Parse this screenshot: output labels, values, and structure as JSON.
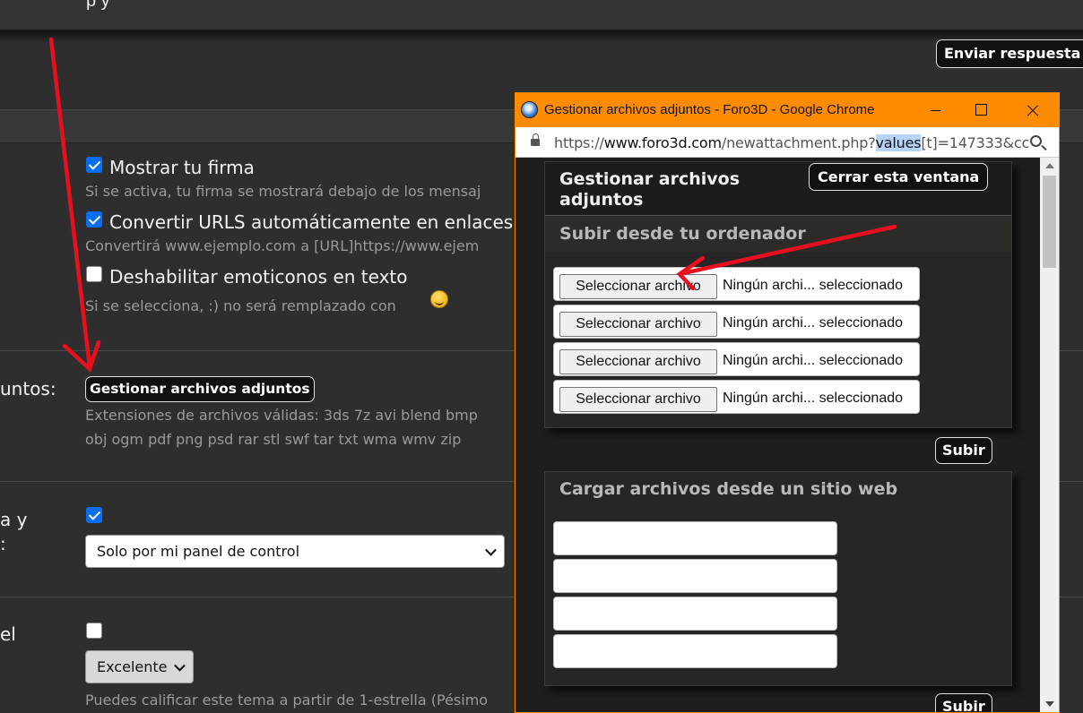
{
  "page": {
    "top_text": "p         y",
    "send_reply_label": "Enviar respuesta",
    "options": [
      {
        "label": "Mostrar tu firma",
        "description": "Si se activa, tu firma se mostrará debajo de los mensaj",
        "checked": true
      },
      {
        "label": "Convertir URLS automáticamente en enlaces",
        "description": "Convertirá www.ejemplo.com a [URL]https://www.ejem",
        "checked": true
      },
      {
        "label": "Deshabilitar emoticonos en texto",
        "description": "Si se selecciona, :) no será remplazado con",
        "checked": false
      }
    ],
    "attachments": {
      "left_label": "untos:",
      "button_label": "Gestionar archivos adjuntos",
      "extensions_line1": "Extensiones de archivos válidas: 3ds 7z avi blend bmp",
      "extensions_line2": "obj ogm pdf png psd rar stl swf tar txt wma wmv zip"
    },
    "subscription": {
      "left_label_1": "a y",
      "left_label_2": ":",
      "checked": true,
      "select_value": "Solo por mi panel de control"
    },
    "rating": {
      "left_label": "el",
      "checked": false,
      "select_value": "Excelente",
      "description": "Puedes calificar este tema a partir de 1-estrella (Pésimo"
    }
  },
  "popup": {
    "window_title": "Gestionar archivos adjuntos - Foro3D - Google Chrome",
    "url_prefix": "https://",
    "url_domain": "www.foro3d.com",
    "url_path": "/newattachment.php?",
    "url_highlight": "values",
    "url_rest": "[t]=147333&cc",
    "panel_title_line1": "Gestionar archivos",
    "panel_title_line2": "adjuntos",
    "close_window_label": "Cerrar esta ventana",
    "upload_section_title": "Subir desde tu ordenador",
    "file_inputs": [
      {
        "button": "Seleccionar archivo",
        "status": "Ningún archi... seleccionado"
      },
      {
        "button": "Seleccionar archivo",
        "status": "Ningún archi... seleccionado"
      },
      {
        "button": "Seleccionar archivo",
        "status": "Ningún archi... seleccionado"
      },
      {
        "button": "Seleccionar archivo",
        "status": "Ningún archi... seleccionado"
      }
    ],
    "upload_button_label": "Subir",
    "web_section_title": "Cargar archivos desde un sitio web",
    "url_inputs": [
      "",
      "",
      "",
      ""
    ],
    "upload_button_2_label": "Subir"
  },
  "colors": {
    "background": "#2e2e2e",
    "titlebar": "#ff8c00",
    "checkbox_accent": "#0a6ef0",
    "annotation_arrow": "#e8101e"
  }
}
